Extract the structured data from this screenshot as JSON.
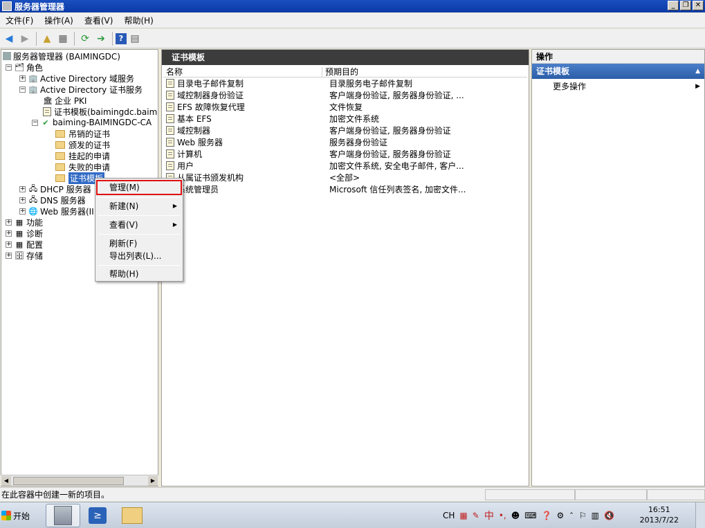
{
  "window": {
    "title": "服务器管理器"
  },
  "menu": [
    "文件(F)",
    "操作(A)",
    "查看(V)",
    "帮助(H)"
  ],
  "tree": {
    "root": "服务器管理器 (BAIMINGDC)",
    "roles": "角色",
    "ad_domain": "Active Directory 域服务",
    "ad_cert": "Active Directory 证书服务",
    "enterprise_pki": "企业 PKI",
    "cert_templates_node": "证书模板(baimingdc.baimi",
    "ca": "baiming-BAIMINGDC-CA",
    "revoked": "吊销的证书",
    "issued": "颁发的证书",
    "pending": "挂起的申请",
    "failed": "失败的申请",
    "templates": "证书模板",
    "dhcp": "DHCP 服务器",
    "dns": "DNS 服务器",
    "web": "Web 服务器(II",
    "features": "功能",
    "diagnostics": "诊断",
    "configuration": "配置",
    "storage": "存储"
  },
  "center": {
    "title": "证书模板",
    "col_name": "名称",
    "col_purpose": "预期目的",
    "rows": [
      {
        "name": "目录电子邮件复制",
        "purpose": "目录服务电子邮件复制"
      },
      {
        "name": "域控制器身份验证",
        "purpose": "客户端身份验证, 服务器身份验证, ..."
      },
      {
        "name": "EFS 故障恢复代理",
        "purpose": "文件恢复"
      },
      {
        "name": "基本 EFS",
        "purpose": "加密文件系统"
      },
      {
        "name": "域控制器",
        "purpose": "客户端身份验证, 服务器身份验证"
      },
      {
        "name": "Web 服务器",
        "purpose": "服务器身份验证"
      },
      {
        "name": "计算机",
        "purpose": "客户端身份验证, 服务器身份验证"
      },
      {
        "name": "用户",
        "purpose": "加密文件系统, 安全电子邮件, 客户..."
      },
      {
        "name": "从属证书颁发机构",
        "purpose": "<全部>"
      },
      {
        "name": "系统管理员",
        "purpose": "Microsoft 信任列表签名, 加密文件..."
      }
    ]
  },
  "actions": {
    "header": "操作",
    "section": "证书模板",
    "more": "更多操作"
  },
  "context_menu": {
    "manage": "管理(M)",
    "new": "新建(N)",
    "view": "查看(V)",
    "refresh": "刷新(F)",
    "export": "导出列表(L)...",
    "help": "帮助(H)"
  },
  "status": {
    "text": "在此容器中创建一新的项目。"
  },
  "taskbar": {
    "start": "开始",
    "lang": "CH",
    "ime": "中",
    "time": "16:51",
    "date": "2013/7/22"
  },
  "colors": {
    "selection": "#316ac5",
    "highlight_box": "#e01010",
    "pane_header": "#3c3c3c"
  }
}
